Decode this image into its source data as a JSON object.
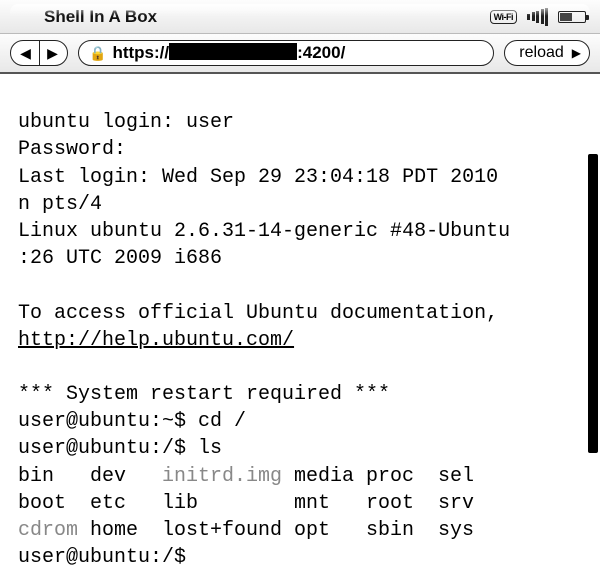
{
  "titlebar": {
    "title": "Shell In A Box"
  },
  "toolbar": {
    "scheme": "https://",
    "port_path": ":4200/",
    "reload_label": "reload"
  },
  "terminal": {
    "login_line": "ubuntu login: user",
    "password_line": "Password:",
    "last_login_a": "Last login: Wed Sep 29 23:04:18 PDT 2010",
    "last_login_b": "n pts/4",
    "uname_a": "Linux ubuntu 2.6.31-14-generic #48-Ubuntu",
    "uname_b": ":26 UTC 2009 i686",
    "docs_line": "To access official Ubuntu documentation,",
    "docs_link": "http://help.ubuntu.com/",
    "restart_line": "*** System restart required ***",
    "prompt1": "user@ubuntu:~$ cd /",
    "prompt2": "user@ubuntu:/$ ls",
    "prompt3": "user@ubuntu:/$ ",
    "ls": {
      "rows": [
        [
          "bin",
          "dev",
          "initrd.img",
          "media",
          "proc",
          "sel"
        ],
        [
          "boot",
          "etc",
          "lib",
          "mnt",
          "root",
          "srv"
        ],
        [
          "cdrom",
          "home",
          "lost+found",
          "opt",
          "sbin",
          "sys"
        ]
      ],
      "dim": [
        "initrd.img",
        "cdrom"
      ]
    }
  }
}
